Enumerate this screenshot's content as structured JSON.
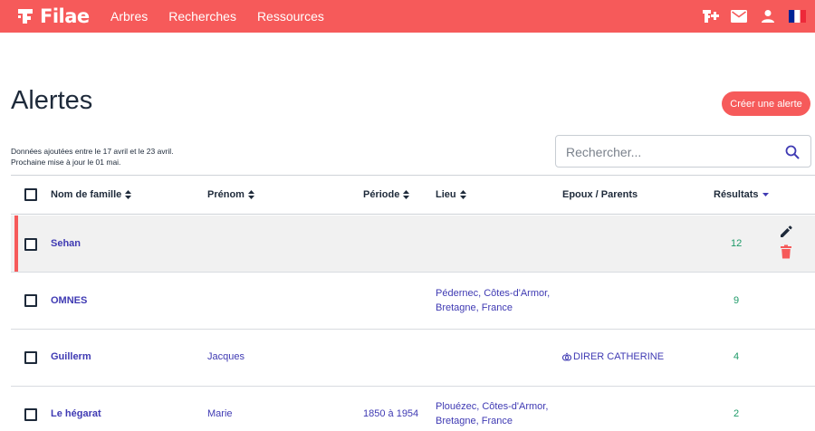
{
  "header": {
    "logo_text": "Filae",
    "nav": [
      "Arbres",
      "Recherches",
      "Ressources"
    ],
    "icons": [
      "add-tree-icon",
      "mail-icon",
      "user-icon",
      "france-flag-icon"
    ]
  },
  "page": {
    "title": "Alertes",
    "create_label": "Créer une alerte",
    "info_line1": "Données ajoutées entre le 17 avril et le 23 avril.",
    "info_line2": "Prochaine mise à jour le 01 mai.",
    "search_placeholder": "Rechercher..."
  },
  "table": {
    "columns": {
      "nom": "Nom de famille",
      "prenom": "Prénom",
      "periode": "Période",
      "lieu": "Lieu",
      "epoux": "Epoux / Parents",
      "resultats": "Résultats"
    },
    "rows": [
      {
        "nom": "Sehan",
        "prenom": "",
        "periode": "",
        "lieu_line1": "",
        "lieu_line2": "",
        "epoux": "",
        "resultats": "12",
        "selected": true
      },
      {
        "nom": "OMNES",
        "prenom": "",
        "periode": "",
        "lieu_line1": "Pédernec, Côtes-d'Armor,",
        "lieu_line2": "Bretagne, France",
        "epoux": "",
        "resultats": "9",
        "selected": false
      },
      {
        "nom": "Guillerm",
        "prenom": "Jacques",
        "periode": "",
        "lieu_line1": "",
        "lieu_line2": "",
        "epoux": "DIRER CATHERINE",
        "resultats": "4",
        "selected": false
      },
      {
        "nom": "Le hégarat",
        "prenom": "Marie",
        "periode": "1850 à 1954",
        "lieu_line1": "Plouézec, Côtes-d'Armor,",
        "lieu_line2": "Bretagne, France",
        "epoux": "",
        "resultats": "2",
        "selected": false
      }
    ]
  },
  "colors": {
    "brand": "#f65a5a",
    "link": "#3f3ab3",
    "results": "#1e9a68",
    "text": "#1e2a3a"
  }
}
